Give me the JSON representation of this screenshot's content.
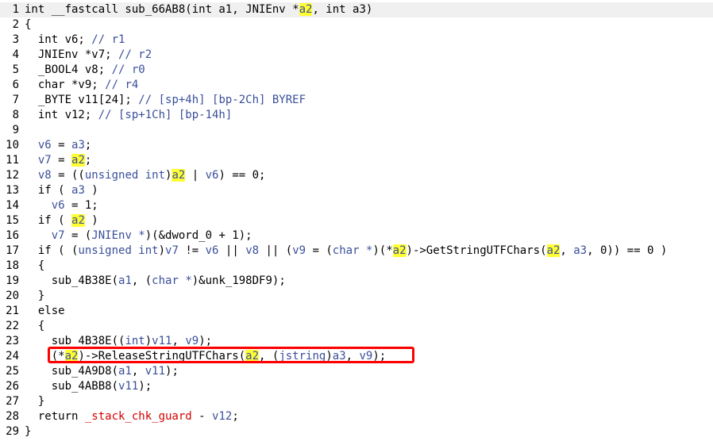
{
  "editor": {
    "highlight_color": "#ffff33",
    "annotation_color": "#ff0000",
    "lines": [
      {
        "n": "1",
        "t": [
          [
            "int __fastcall sub_66AB8(int a1, JNIEnv *",
            ""
          ],
          [
            "a2",
            "hl"
          ],
          [
            ", int a3)",
            ""
          ]
        ]
      },
      {
        "n": "2",
        "t": [
          [
            "{",
            ""
          ]
        ]
      },
      {
        "n": "3",
        "t": [
          [
            "  int v6; ",
            ""
          ],
          [
            "// r1",
            "cmt"
          ]
        ]
      },
      {
        "n": "4",
        "t": [
          [
            "  JNIEnv *v7; ",
            ""
          ],
          [
            "// r2",
            "cmt"
          ]
        ]
      },
      {
        "n": "5",
        "t": [
          [
            "  _BOOL4 v8; ",
            ""
          ],
          [
            "// r0",
            "cmt"
          ]
        ]
      },
      {
        "n": "6",
        "t": [
          [
            "  char *v9; ",
            ""
          ],
          [
            "// r4",
            "cmt"
          ]
        ]
      },
      {
        "n": "7",
        "t": [
          [
            "  _BYTE v11[24]; ",
            ""
          ],
          [
            "// [sp+4h] [bp-2Ch] BYREF",
            "cmt"
          ]
        ]
      },
      {
        "n": "8",
        "t": [
          [
            "  int v12; ",
            ""
          ],
          [
            "// [sp+1Ch] [bp-14h]",
            "cmt"
          ]
        ]
      },
      {
        "n": "9",
        "t": []
      },
      {
        "n": "10",
        "t": [
          [
            "  ",
            ""
          ],
          [
            "v6",
            "var"
          ],
          [
            " = ",
            ""
          ],
          [
            "a3",
            "var"
          ],
          [
            ";",
            ""
          ]
        ]
      },
      {
        "n": "11",
        "t": [
          [
            "  ",
            ""
          ],
          [
            "v7",
            "var"
          ],
          [
            " = ",
            ""
          ],
          [
            "a2",
            "hl"
          ],
          [
            ";",
            ""
          ]
        ]
      },
      {
        "n": "12",
        "t": [
          [
            "  ",
            ""
          ],
          [
            "v8",
            "var"
          ],
          [
            " = ((",
            ""
          ],
          [
            "unsigned int",
            "cast"
          ],
          [
            ")",
            ""
          ],
          [
            "a2",
            "hl"
          ],
          [
            " | ",
            ""
          ],
          [
            "v6",
            "var"
          ],
          [
            ") == 0;",
            ""
          ]
        ]
      },
      {
        "n": "13",
        "t": [
          [
            "  if ( ",
            ""
          ],
          [
            "a3",
            "var"
          ],
          [
            " )",
            ""
          ]
        ]
      },
      {
        "n": "14",
        "t": [
          [
            "    ",
            ""
          ],
          [
            "v6",
            "var"
          ],
          [
            " = 1;",
            ""
          ]
        ]
      },
      {
        "n": "15",
        "t": [
          [
            "  if ( ",
            ""
          ],
          [
            "a2",
            "hl"
          ],
          [
            " )",
            ""
          ]
        ]
      },
      {
        "n": "16",
        "t": [
          [
            "    ",
            ""
          ],
          [
            "v7",
            "var"
          ],
          [
            " = (",
            ""
          ],
          [
            "JNIEnv *",
            "cast"
          ],
          [
            ")(&dword_0 + 1);",
            ""
          ]
        ]
      },
      {
        "n": "17",
        "t": [
          [
            "  if ( (",
            ""
          ],
          [
            "unsigned int",
            "cast"
          ],
          [
            ")",
            ""
          ],
          [
            "v7",
            "var"
          ],
          [
            " != ",
            ""
          ],
          [
            "v6",
            "var"
          ],
          [
            " || ",
            ""
          ],
          [
            "v8",
            "var"
          ],
          [
            " || (",
            ""
          ],
          [
            "v9",
            "var"
          ],
          [
            " = (",
            ""
          ],
          [
            "char *",
            "cast"
          ],
          [
            ")(*",
            ""
          ],
          [
            "a2",
            "hl"
          ],
          [
            ")->GetStringUTFChars(",
            ""
          ],
          [
            "a2",
            "hl"
          ],
          [
            ", ",
            ""
          ],
          [
            "a3",
            "var"
          ],
          [
            ", 0)) == 0 )",
            ""
          ]
        ]
      },
      {
        "n": "18",
        "t": [
          [
            "  {",
            ""
          ]
        ]
      },
      {
        "n": "19",
        "t": [
          [
            "    sub_4B38E(",
            ""
          ],
          [
            "a1",
            "var"
          ],
          [
            ", (",
            ""
          ],
          [
            "char *",
            "cast"
          ],
          [
            ")&unk_198DF9);",
            ""
          ]
        ]
      },
      {
        "n": "20",
        "t": [
          [
            "  }",
            ""
          ]
        ]
      },
      {
        "n": "21",
        "t": [
          [
            "  else",
            ""
          ]
        ]
      },
      {
        "n": "22",
        "t": [
          [
            "  {",
            ""
          ]
        ]
      },
      {
        "n": "23",
        "t": [
          [
            "    sub_4B38E((",
            ""
          ],
          [
            "int",
            "cast"
          ],
          [
            ")",
            ""
          ],
          [
            "v11",
            "var"
          ],
          [
            ", ",
            ""
          ],
          [
            "v9",
            "var"
          ],
          [
            ");",
            ""
          ]
        ]
      },
      {
        "n": "24",
        "t": [
          [
            "    (*",
            ""
          ],
          [
            "a2",
            "hl"
          ],
          [
            ")->ReleaseStringUTFChars(",
            ""
          ],
          [
            "a2",
            "hl"
          ],
          [
            ", (",
            ""
          ],
          [
            "jstring",
            "cast"
          ],
          [
            ")",
            ""
          ],
          [
            "a3",
            "var"
          ],
          [
            ", ",
            ""
          ],
          [
            "v9",
            "var"
          ],
          [
            ");",
            ""
          ]
        ]
      },
      {
        "n": "25",
        "t": [
          [
            "    sub_4A9D8(",
            ""
          ],
          [
            "a1",
            "var"
          ],
          [
            ", ",
            ""
          ],
          [
            "v11",
            "var"
          ],
          [
            ");",
            ""
          ]
        ]
      },
      {
        "n": "26",
        "t": [
          [
            "    sub_4ABB8(",
            ""
          ],
          [
            "v11",
            "var"
          ],
          [
            ");",
            ""
          ]
        ]
      },
      {
        "n": "27",
        "t": [
          [
            "  }",
            ""
          ]
        ]
      },
      {
        "n": "28",
        "t": [
          [
            "  return ",
            ""
          ],
          [
            "_stack_chk_guard",
            "red"
          ],
          [
            " - ",
            ""
          ],
          [
            "v12",
            "var"
          ],
          [
            ";",
            ""
          ]
        ]
      },
      {
        "n": "29",
        "t": [
          [
            "}",
            ""
          ]
        ]
      }
    ]
  }
}
